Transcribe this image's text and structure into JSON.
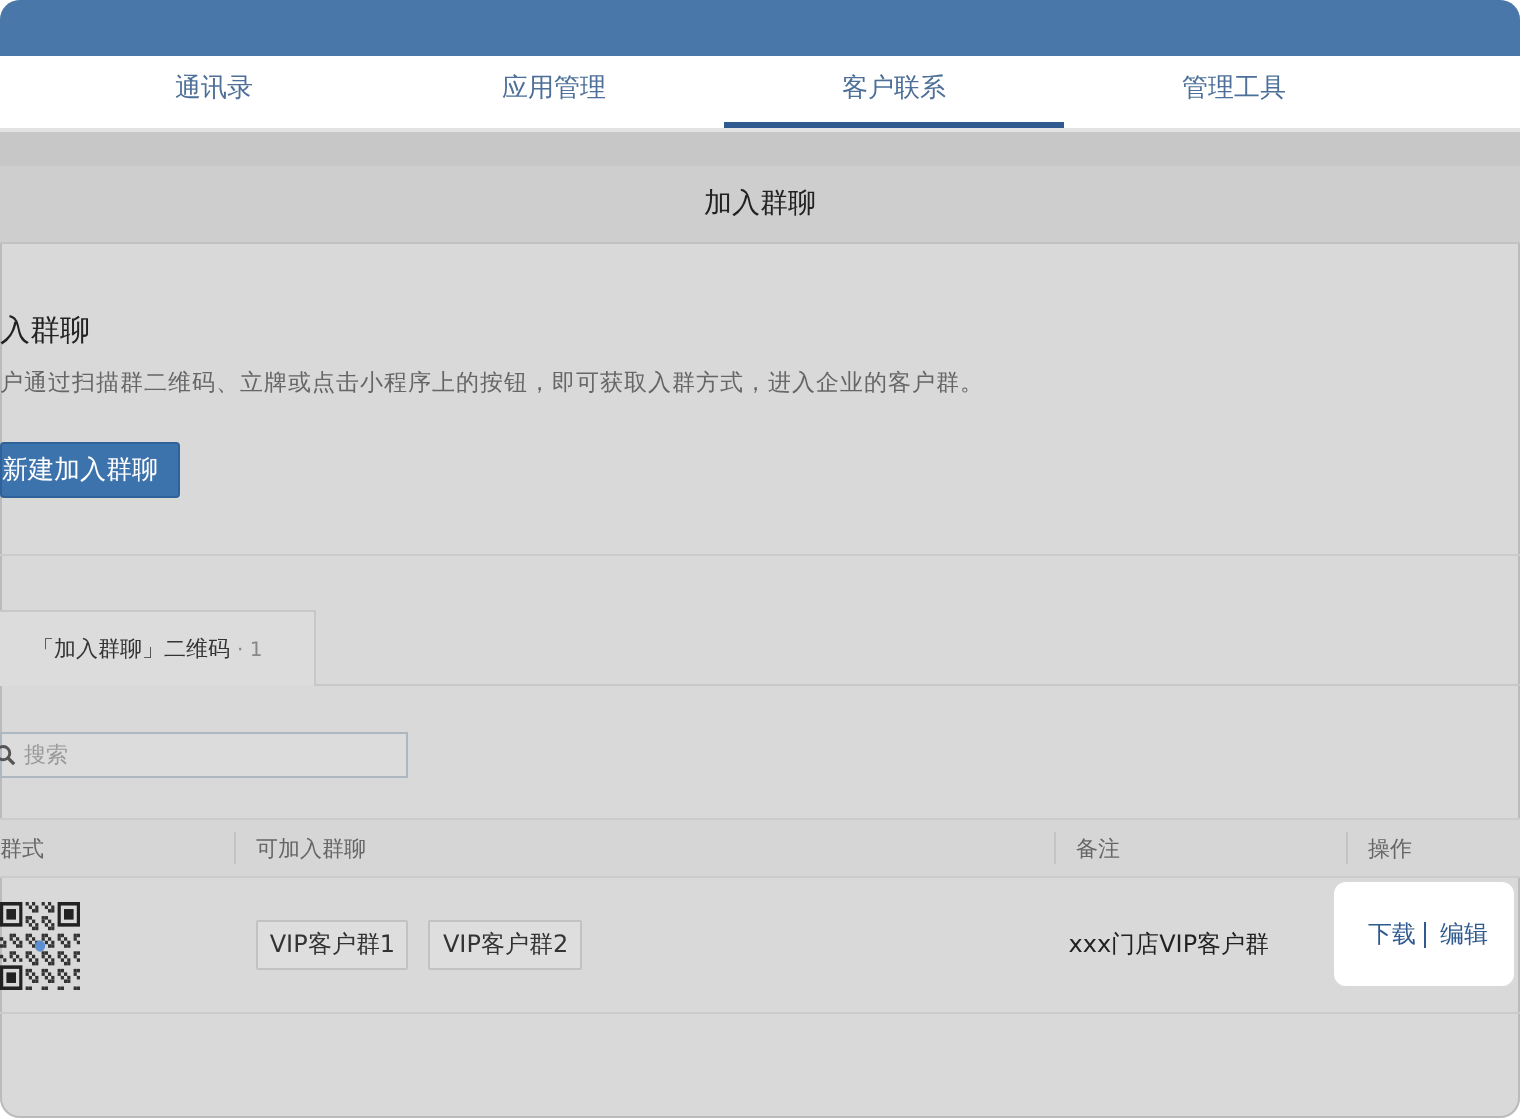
{
  "nav_tabs": [
    {
      "label": "通讯录",
      "selected": false
    },
    {
      "label": "应用管理",
      "selected": false
    },
    {
      "label": "客户联系",
      "selected": true
    },
    {
      "label": "管理工具",
      "selected": false
    }
  ],
  "page_title": "加入群聊",
  "section": {
    "title": "入群聊",
    "description": "户通过扫描群二维码、立牌或点击小程序上的按钮，即可获取入群方式，进入企业的客户群。",
    "create_button": "新建加入群聊"
  },
  "sub_tabs": [
    {
      "label": "「加入群聊」二维码",
      "count": "· 1",
      "selected": true
    }
  ],
  "search": {
    "placeholder": "搜索"
  },
  "table": {
    "columns": [
      "群式",
      "可加入群聊",
      "备注",
      "操作"
    ],
    "rows": [
      {
        "groups": [
          "VIP客户群1",
          "VIP客户群2"
        ],
        "note": "xxx门店VIP客户群",
        "actions": [
          "下载",
          "编辑"
        ]
      }
    ]
  }
}
